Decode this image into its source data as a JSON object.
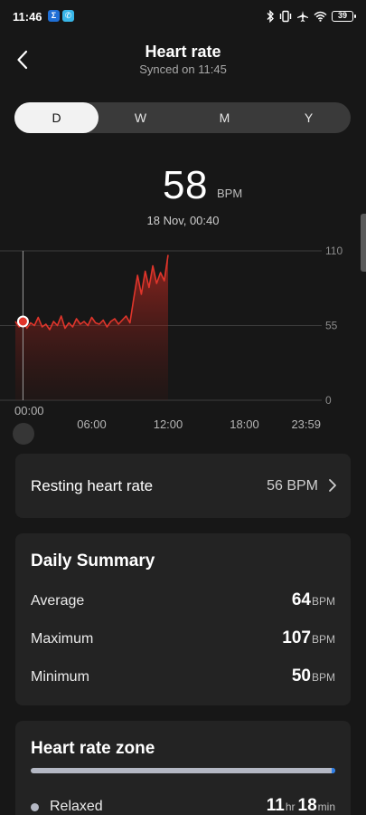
{
  "status_bar": {
    "time": "11:46",
    "battery": "39",
    "app_icons": [
      "sigma-app-icon",
      "phone-app-icon"
    ],
    "system_icons": [
      "bluetooth-icon",
      "vibrate-icon",
      "airplane-icon",
      "wifi-icon",
      "battery-icon"
    ]
  },
  "header": {
    "title": "Heart rate",
    "subtitle": "Synced on 11:45",
    "back_icon": "chevron-left-icon"
  },
  "period_tabs": [
    {
      "label": "D",
      "selected": true
    },
    {
      "label": "W",
      "selected": false
    },
    {
      "label": "M",
      "selected": false
    },
    {
      "label": "Y",
      "selected": false
    }
  ],
  "reading": {
    "value": "58",
    "unit": "BPM",
    "datetime": "18 Nov, 00:40"
  },
  "chart_data": {
    "type": "area",
    "y_ticks": [
      "110",
      "55",
      "0"
    ],
    "x_ticks": [
      "00:00",
      "06:00",
      "12:00",
      "18:00",
      "23:59"
    ],
    "ylim": [
      0,
      110
    ],
    "xlim_hours": [
      0,
      24
    ],
    "grid": true,
    "color": "#e0352b",
    "selected_point": {
      "x": 0.67,
      "y": 58
    },
    "x": [
      0,
      0.3,
      0.6,
      0.9,
      1.2,
      1.5,
      1.8,
      2.1,
      2.4,
      2.7,
      3.0,
      3.3,
      3.6,
      3.9,
      4.2,
      4.5,
      4.8,
      5.1,
      5.4,
      5.7,
      6.0,
      6.3,
      6.6,
      6.9,
      7.2,
      7.5,
      7.8,
      8.1,
      8.4,
      8.7,
      9.0,
      9.3,
      9.6,
      9.9,
      10.2,
      10.5,
      10.8,
      11.1,
      11.4,
      11.7,
      12.0
    ],
    "y": [
      58,
      54,
      60,
      53,
      57,
      55,
      61,
      54,
      56,
      52,
      58,
      55,
      62,
      53,
      57,
      54,
      60,
      56,
      58,
      55,
      61,
      57,
      56,
      59,
      54,
      58,
      60,
      56,
      59,
      62,
      57,
      75,
      92,
      78,
      95,
      83,
      99,
      86,
      94,
      88,
      107
    ]
  },
  "resting": {
    "label": "Resting heart rate",
    "value": "56 BPM"
  },
  "summary": {
    "title": "Daily Summary",
    "rows": [
      {
        "label": "Average",
        "value": "64",
        "unit": "BPM"
      },
      {
        "label": "Maximum",
        "value": "107",
        "unit": "BPM"
      },
      {
        "label": "Minimum",
        "value": "50",
        "unit": "BPM"
      }
    ]
  },
  "zones": {
    "title": "Heart rate zone",
    "items": [
      {
        "label": "Relaxed",
        "hours": "11",
        "hours_unit": "hr",
        "minutes": "18",
        "minutes_unit": "min"
      }
    ],
    "colors": {
      "relaxed": "#b4b8c4",
      "accent": "#2c7ee8"
    }
  }
}
